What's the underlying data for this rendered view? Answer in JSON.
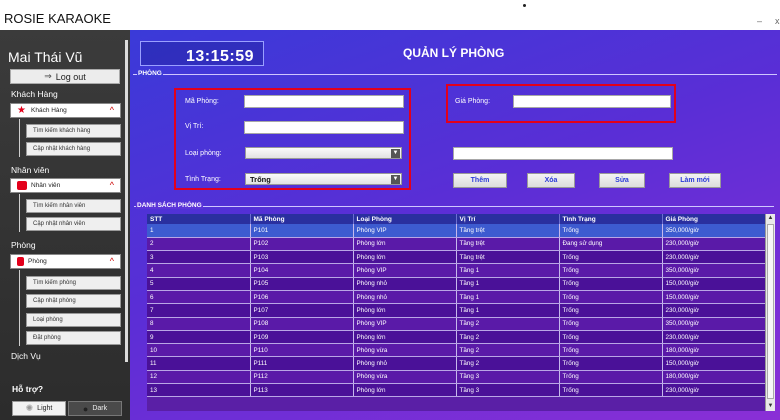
{
  "app": {
    "title": "ROSIE KARAOKE",
    "minimize": "–",
    "close": "x"
  },
  "sidebar": {
    "user_name": "Mai Thái Vũ",
    "logout_label": "Log out",
    "sections": [
      {
        "title": "Khách Hàng",
        "button": "Khách Hàng",
        "items": [
          "Tìm kiếm khách hàng",
          "Cập nhật khách hàng"
        ]
      },
      {
        "title": "Nhân viên",
        "button": "Nhân viên",
        "items": [
          "Tìm kiếm nhân viên",
          "Cập nhật nhân viên"
        ]
      },
      {
        "title": "Phòng",
        "button": "Phòng",
        "items": [
          "Tìm kiếm phòng",
          "Cập nhật phòng",
          "Loại phòng",
          "Đặt phòng"
        ]
      },
      {
        "title": "Dịch Vụ"
      }
    ],
    "help_label": "Hỗ trợ?",
    "theme_light": "Light",
    "theme_dark": "Dark"
  },
  "header": {
    "clock": "13:15:59",
    "page_title": "QUẢN LÝ PHÒNG"
  },
  "form": {
    "legend": "PHÒNG",
    "label_room_code": "Mã Phòng:",
    "label_location": "Vị Trí:",
    "label_room_type": "Loại phòng:",
    "label_status": "Tình Trạng:",
    "label_price": "Giá Phòng:",
    "room_code_value": "",
    "location_value": "",
    "room_type_value": "",
    "status_value": "Trống",
    "price_value": "",
    "search_value": ""
  },
  "actions": {
    "add": "Thêm",
    "delete": "Xóa",
    "edit": "Sửa",
    "reset": "Làm mới"
  },
  "list": {
    "legend": "DANH SÁCH PHÒNG",
    "columns": [
      "STT",
      "Mã Phòng",
      "Loại Phòng",
      "Vị Trí",
      "Tình Trạng",
      "Giá Phòng"
    ],
    "rows": [
      [
        "1",
        "P101",
        "Phòng VIP",
        "Tầng trệt",
        "Trống",
        "350,000/giờ"
      ],
      [
        "2",
        "P102",
        "Phòng lớn",
        "Tầng trệt",
        "Đang sử dụng",
        "230,000/giờ"
      ],
      [
        "3",
        "P103",
        "Phòng lớn",
        "Tầng trệt",
        "Trống",
        "230,000/giờ"
      ],
      [
        "4",
        "P104",
        "Phòng VIP",
        "Tầng 1",
        "Trống",
        "350,000/giờ"
      ],
      [
        "5",
        "P105",
        "Phòng nhỏ",
        "Tầng 1",
        "Trống",
        "150,000/giờ"
      ],
      [
        "6",
        "P106",
        "Phòng nhỏ",
        "Tầng 1",
        "Trống",
        "150,000/giờ"
      ],
      [
        "7",
        "P107",
        "Phòng lớn",
        "Tầng 1",
        "Trống",
        "230,000/giờ"
      ],
      [
        "8",
        "P108",
        "Phòng VIP",
        "Tầng 2",
        "Trống",
        "350,000/giờ"
      ],
      [
        "9",
        "P109",
        "Phòng lớn",
        "Tầng 2",
        "Trống",
        "230,000/giờ"
      ],
      [
        "10",
        "P110",
        "Phòng vừa",
        "Tầng 2",
        "Trống",
        "180,000/giờ"
      ],
      [
        "11",
        "P111",
        "Phòng nhỏ",
        "Tầng 2",
        "Trống",
        "150,000/giờ"
      ],
      [
        "12",
        "P112",
        "Phòng vừa",
        "Tầng 3",
        "Trống",
        "180,000/giờ"
      ],
      [
        "13",
        "P113",
        "Phòng lớn",
        "Tầng 3",
        "Trống",
        "230,000/giờ"
      ]
    ]
  },
  "colors": {
    "accent_red": "#e3001b",
    "header_blue": "#2a2f9f",
    "row_purple": "#4a1198"
  },
  "icons": {
    "logout": "logout-arrow-icon",
    "customer": "star-icon",
    "staff": "staff-icon",
    "room": "room-icon"
  }
}
